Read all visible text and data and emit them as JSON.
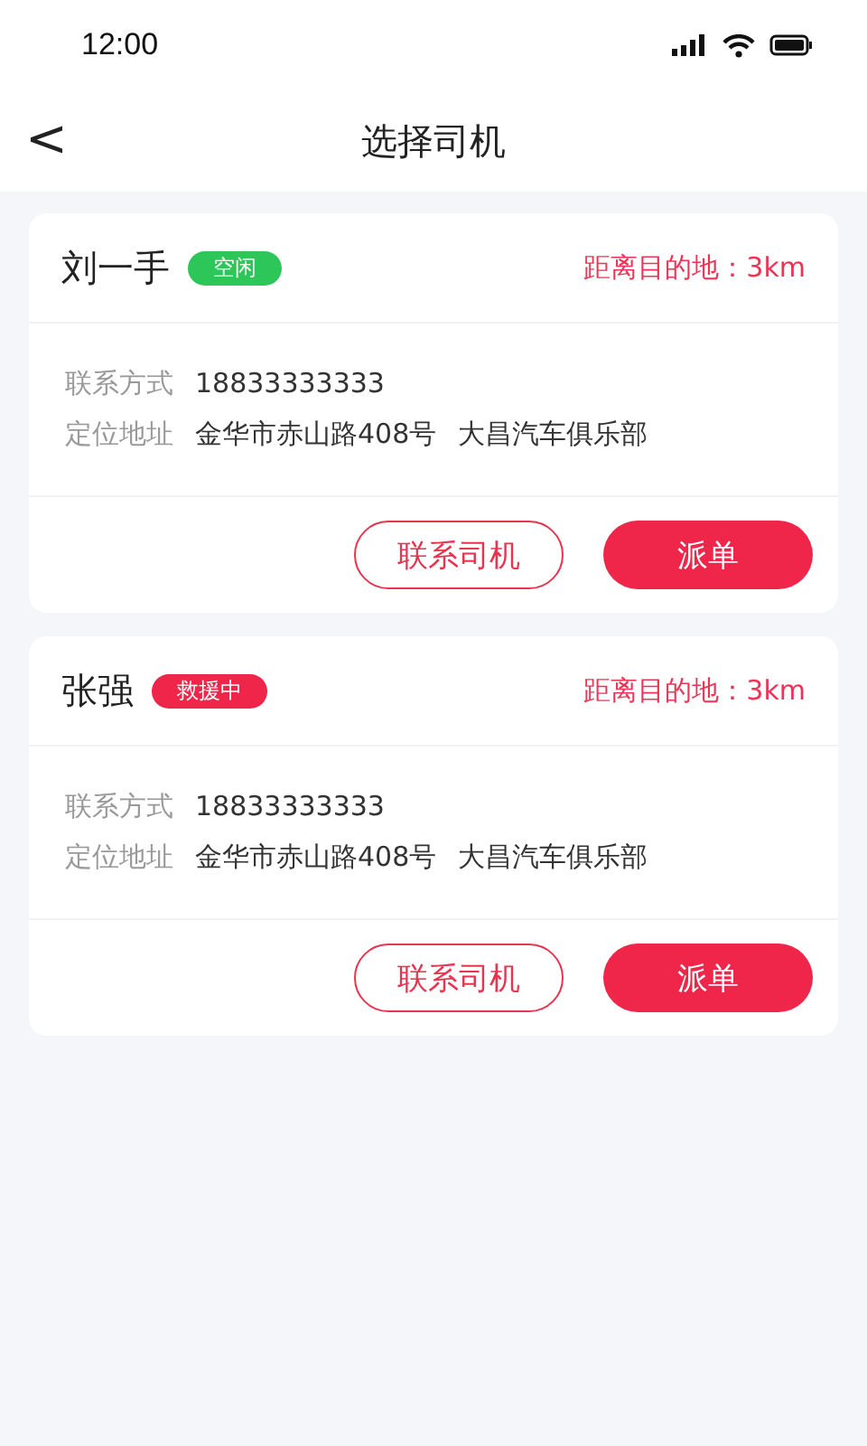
{
  "status_bar": {
    "time": "12:00"
  },
  "header": {
    "back": "<",
    "title": "选择司机"
  },
  "drivers": [
    {
      "name": "刘一手",
      "status": "空闲",
      "color": "#2dc659",
      "distance": "距离目的地：3km",
      "contact_label": "联系方式",
      "phone": "18833333333",
      "address_label": "定位地址",
      "address": [
        "金华市赤山路408号",
        "大昌汽车俱乐部"
      ],
      "contact_button": "联系司机",
      "dispatch_button": "派单"
    },
    {
      "name": "张强",
      "status": "救援中",
      "color": "#f0254a",
      "distance": "距离目的地：3km",
      "contact_label": "联系方式",
      "phone": "18833333333",
      "address_label": "定位地址",
      "address": [
        "金华市赤山路408号",
        "大昌汽车俱乐部"
      ],
      "contact_button": "联系司机",
      "dispatch_button": "派单"
    }
  ]
}
